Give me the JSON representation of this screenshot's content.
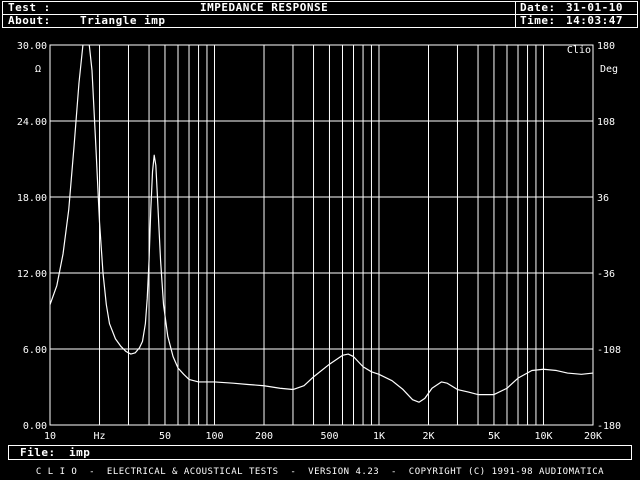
{
  "header": {
    "test_label": "Test :",
    "about_label": "About:",
    "title": "IMPEDANCE RESPONSE",
    "about_value": "Triangle imp",
    "date_label": "Date:",
    "date_value": "31-01-10",
    "time_label": "Time:",
    "time_value": "14:03:47"
  },
  "file_bar": {
    "label": "File:",
    "value": "imp"
  },
  "footer": {
    "text": "C L I O  -  ELECTRICAL & ACOUSTICAL TESTS  -  VERSION 4.23  -  COPYRIGHT (C) 1991-98 AUDIOMATICA"
  },
  "chart_data": {
    "type": "line",
    "title": "IMPEDANCE RESPONSE",
    "logo": "Clio",
    "left_unit": "Ω",
    "right_unit": "Deg",
    "x_scale": "log",
    "xlim": [
      10,
      20000
    ],
    "ylim": [
      0,
      30
    ],
    "y2lim": [
      -180,
      180
    ],
    "grid": true,
    "x_ticks": [
      {
        "v": 10,
        "label": "10"
      },
      {
        "v": 20,
        "label": "Hz"
      },
      {
        "v": 50,
        "label": "50"
      },
      {
        "v": 100,
        "label": "100"
      },
      {
        "v": 200,
        "label": "200"
      },
      {
        "v": 500,
        "label": "500"
      },
      {
        "v": 1000,
        "label": "1K"
      },
      {
        "v": 2000,
        "label": "2K"
      },
      {
        "v": 5000,
        "label": "5K"
      },
      {
        "v": 10000,
        "label": "10K"
      },
      {
        "v": 20000,
        "label": "20K"
      }
    ],
    "y_ticks": [
      "0.00",
      "6.00",
      "12.00",
      "18.00",
      "24.00",
      "30.00"
    ],
    "y2_ticks": [
      "-180",
      "-108",
      "-36",
      "36",
      "108",
      "180"
    ],
    "series": [
      {
        "color": "#ffffff",
        "points": [
          [
            10,
            9.5
          ],
          [
            11,
            11
          ],
          [
            12,
            13.5
          ],
          [
            13,
            17
          ],
          [
            14,
            22
          ],
          [
            15,
            27
          ],
          [
            16,
            30.5
          ],
          [
            17,
            31
          ],
          [
            18,
            28
          ],
          [
            19,
            22
          ],
          [
            20,
            16
          ],
          [
            21,
            12
          ],
          [
            22,
            9.5
          ],
          [
            23,
            8
          ],
          [
            25,
            6.8
          ],
          [
            27,
            6.2
          ],
          [
            29,
            5.8
          ],
          [
            31,
            5.6
          ],
          [
            33,
            5.7
          ],
          [
            35,
            6.1
          ],
          [
            36.5,
            6.6
          ],
          [
            38,
            8
          ],
          [
            39,
            10
          ],
          [
            40,
            13
          ],
          [
            41,
            17
          ],
          [
            42,
            20
          ],
          [
            43,
            21.3
          ],
          [
            44,
            20.5
          ],
          [
            45,
            18
          ],
          [
            47,
            13
          ],
          [
            49,
            9.5
          ],
          [
            52,
            7
          ],
          [
            56,
            5.4
          ],
          [
            60,
            4.5
          ],
          [
            65,
            4
          ],
          [
            70,
            3.6
          ],
          [
            80,
            3.4
          ],
          [
            100,
            3.4
          ],
          [
            130,
            3.3
          ],
          [
            160,
            3.2
          ],
          [
            200,
            3.1
          ],
          [
            250,
            2.9
          ],
          [
            300,
            2.8
          ],
          [
            350,
            3.1
          ],
          [
            400,
            3.8
          ],
          [
            500,
            4.8
          ],
          [
            600,
            5.5
          ],
          [
            650,
            5.6
          ],
          [
            700,
            5.4
          ],
          [
            800,
            4.6
          ],
          [
            900,
            4.2
          ],
          [
            1000,
            4.0
          ],
          [
            1200,
            3.5
          ],
          [
            1400,
            2.8
          ],
          [
            1600,
            2.0
          ],
          [
            1750,
            1.8
          ],
          [
            1900,
            2.1
          ],
          [
            2100,
            2.9
          ],
          [
            2400,
            3.4
          ],
          [
            2600,
            3.3
          ],
          [
            3000,
            2.8
          ],
          [
            3500,
            2.6
          ],
          [
            4000,
            2.4
          ],
          [
            5000,
            2.4
          ],
          [
            6000,
            2.9
          ],
          [
            7000,
            3.7
          ],
          [
            8500,
            4.3
          ],
          [
            10000,
            4.4
          ],
          [
            12000,
            4.3
          ],
          [
            14000,
            4.1
          ],
          [
            17000,
            4.0
          ],
          [
            20000,
            4.1
          ]
        ]
      }
    ]
  }
}
